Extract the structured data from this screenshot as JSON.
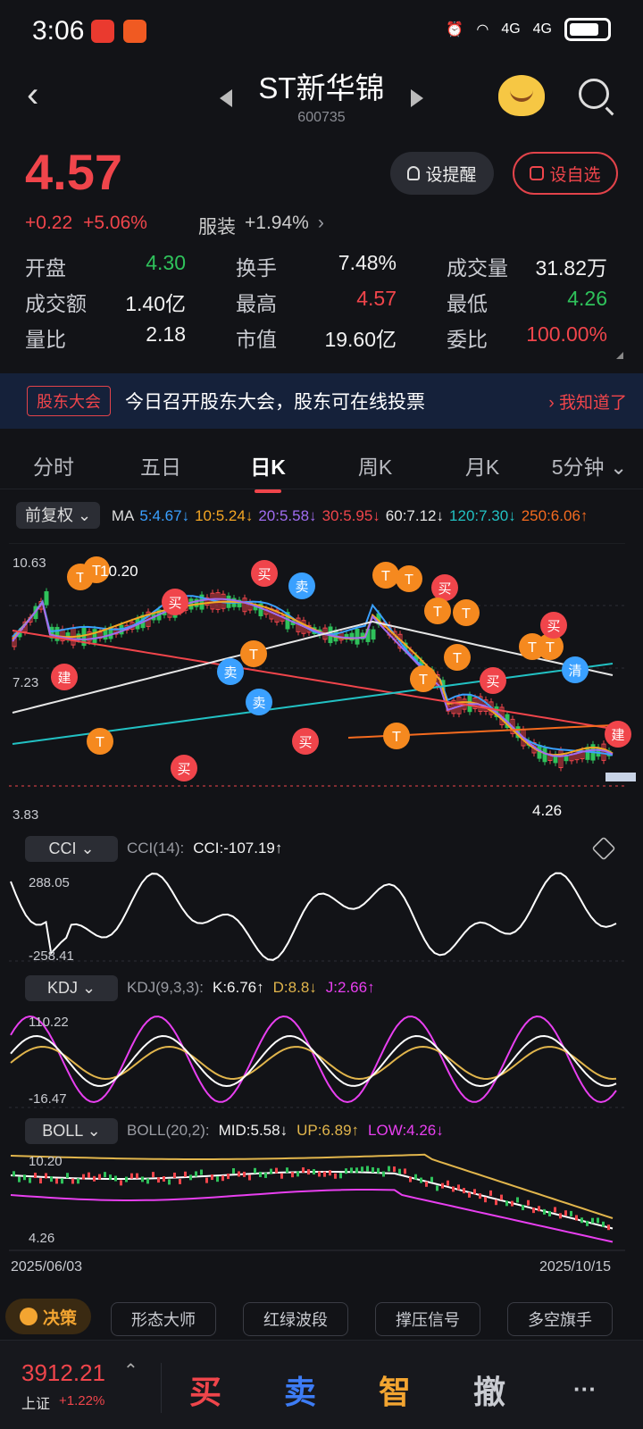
{
  "status": {
    "time": "3:06",
    "net1": "4G",
    "net2": "4G"
  },
  "header": {
    "title": "ST新华锦",
    "code": "600735"
  },
  "quote": {
    "price": "4.57",
    "change": "+0.22",
    "change_pct": "+5.06%",
    "sector": "服装",
    "sector_pct": "+1.94%",
    "alert_label": "设提醒",
    "fav_label": "设自选",
    "stats": [
      [
        {
          "label": "开盘",
          "value": "4.30",
          "color": "green"
        },
        {
          "label": "换手",
          "value": "7.48%",
          "color": "white"
        },
        {
          "label": "成交量",
          "value": "31.82万",
          "color": "white"
        }
      ],
      [
        {
          "label": "成交额",
          "value": "1.40亿",
          "color": "white"
        },
        {
          "label": "最高",
          "value": "4.57",
          "color": "red"
        },
        {
          "label": "最低",
          "value": "4.26",
          "color": "green"
        }
      ],
      [
        {
          "label": "量比",
          "value": "2.18",
          "color": "white"
        },
        {
          "label": "市值",
          "value": "19.60亿",
          "color": "white"
        },
        {
          "label": "委比",
          "value": "100.00%",
          "color": "red"
        }
      ]
    ]
  },
  "banner": {
    "tag": "股东大会",
    "text": "今日召开股东大会，股东可在线投票",
    "action": "› 我知道了"
  },
  "tabs": [
    "分时",
    "五日",
    "日K",
    "周K",
    "月K",
    "5分钟 ⌄"
  ],
  "ma": {
    "fq_label": "前复权 ⌄",
    "items": [
      {
        "text": "MA",
        "color": "#dddddd"
      },
      {
        "text": "5:4.67↓",
        "color": "#3aa0ff"
      },
      {
        "text": "10:5.24↓",
        "color": "#f5a623"
      },
      {
        "text": "20:5.58↓",
        "color": "#a06cf0"
      },
      {
        "text": "30:5.95↓",
        "color": "#f0454b"
      },
      {
        "text": "60:7.12↓",
        "color": "#e6e6e6"
      },
      {
        "text": "120:7.30↓",
        "color": "#22c1c3"
      },
      {
        "text": "250:6.06↑",
        "color": "#f56b1f"
      }
    ]
  },
  "kline": {
    "high_label": "10.63",
    "mark_high": "10.20",
    "mid_label": "7.23",
    "low_label": "3.83",
    "mark_low": "4.26"
  },
  "cci": {
    "btn": "CCI ⌄",
    "params": "CCI(14):",
    "value": "CCI:-107.19↑",
    "top": "288.05",
    "bottom": "-258.41"
  },
  "kdj": {
    "btn": "KDJ ⌄",
    "params": "KDJ(9,3,3):",
    "k": "K:6.76↑",
    "d": "D:8.8↓",
    "j": "J:2.66↑",
    "top": "110.22",
    "bottom": "-16.47"
  },
  "boll": {
    "btn": "BOLL ⌄",
    "params": "BOLL(20,2):",
    "mid": "MID:5.58↓",
    "up": "UP:6.89↑",
    "low": "LOW:4.26↓",
    "top": "10.20",
    "bottom": "4.26"
  },
  "dates": {
    "start": "2025/06/03",
    "end": "2025/10/15"
  },
  "strategy": {
    "label": "决策",
    "pills": [
      "形态大师",
      "红绿波段",
      "撑压信号",
      "多空旗手"
    ]
  },
  "bottom": {
    "index_value": "3912.21",
    "index_name": "上证",
    "index_change": "+1.22%",
    "buy": "买",
    "sell": "卖",
    "smart": "智",
    "cancel": "撤",
    "more": "···"
  }
}
